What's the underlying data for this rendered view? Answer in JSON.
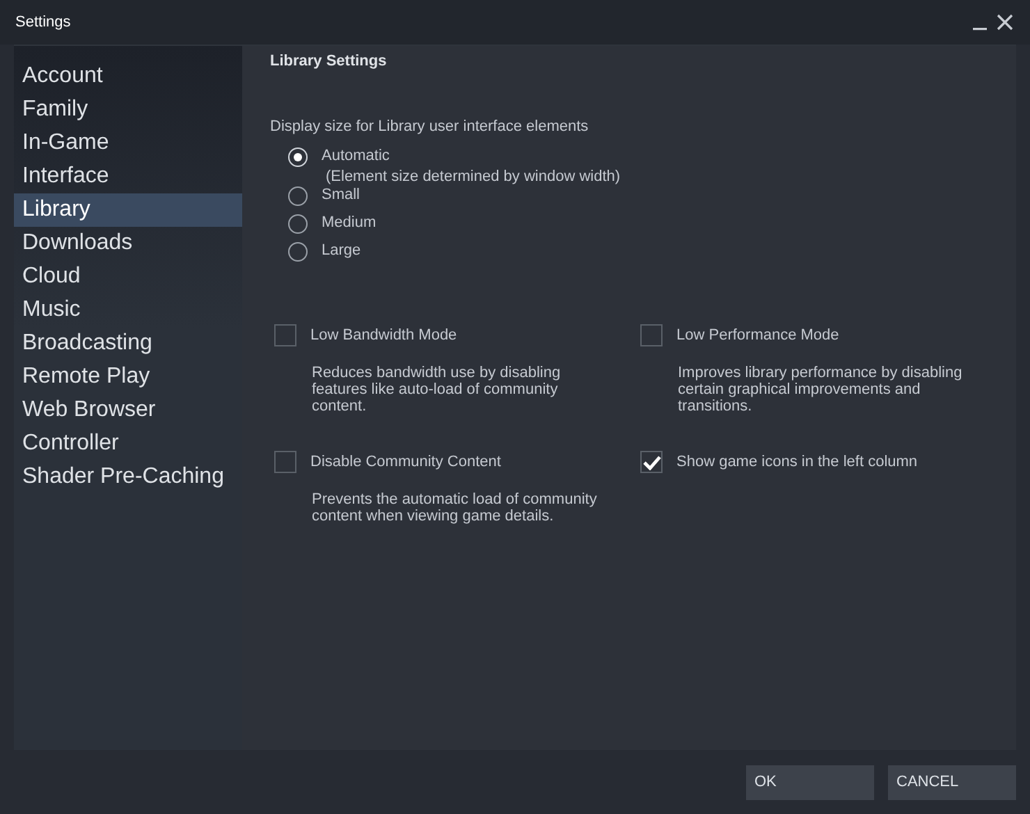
{
  "window": {
    "title": "Settings"
  },
  "sidebar": {
    "items": [
      {
        "label": "Account",
        "selected": false
      },
      {
        "label": "Family",
        "selected": false
      },
      {
        "label": "In-Game",
        "selected": false
      },
      {
        "label": "Interface",
        "selected": false
      },
      {
        "label": "Library",
        "selected": true
      },
      {
        "label": "Downloads",
        "selected": false
      },
      {
        "label": "Cloud",
        "selected": false
      },
      {
        "label": "Music",
        "selected": false
      },
      {
        "label": "Broadcasting",
        "selected": false
      },
      {
        "label": "Remote Play",
        "selected": false
      },
      {
        "label": "Web Browser",
        "selected": false
      },
      {
        "label": "Controller",
        "selected": false
      },
      {
        "label": "Shader Pre-Caching",
        "selected": false
      }
    ]
  },
  "content": {
    "heading": "Library Settings",
    "display_size": {
      "label": "Display size for Library user interface elements",
      "options": [
        {
          "label": "Automatic",
          "note": "(Element size determined by window width)",
          "selected": true
        },
        {
          "label": "Small",
          "selected": false
        },
        {
          "label": "Medium",
          "selected": false
        },
        {
          "label": "Large",
          "selected": false
        }
      ]
    },
    "options": [
      {
        "label": "Low Bandwidth Mode",
        "description": "Reduces bandwidth use by disabling features like auto-load of community content.",
        "checked": false
      },
      {
        "label": "Low Performance Mode",
        "description": "Improves library performance by disabling certain graphical improvements and transitions.",
        "checked": false
      },
      {
        "label": "Disable Community Content",
        "description": "Prevents the automatic load of community content when viewing game details.",
        "checked": false
      },
      {
        "label": "Show game icons in the left column",
        "checked": true
      }
    ]
  },
  "buttons": [
    {
      "label": "OK"
    },
    {
      "label": "CANCEL"
    }
  ]
}
